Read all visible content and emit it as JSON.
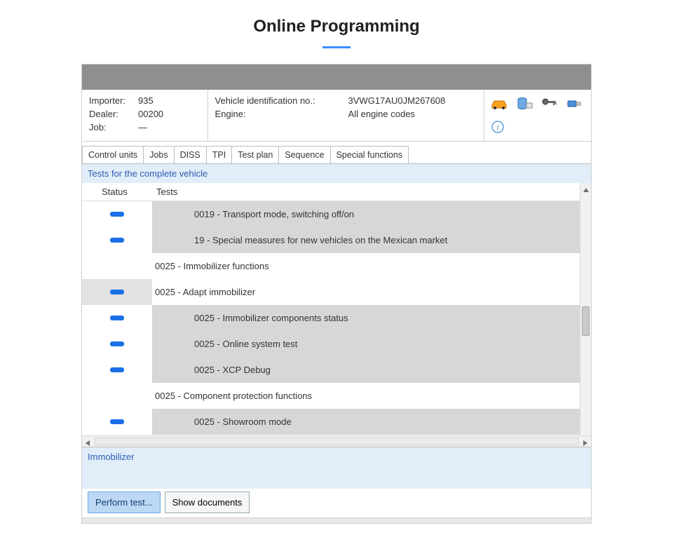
{
  "page": {
    "title": "Online Programming"
  },
  "info": {
    "importer_label": "Importer:",
    "importer_value": "935",
    "dealer_label": "Dealer:",
    "dealer_value": "00200",
    "job_label": "Job:",
    "job_value": "—",
    "vin_label": "Vehicle identification no.:",
    "vin_value": "3VWG17AU0JM267608",
    "engine_label": "Engine:",
    "engine_value": "All engine codes"
  },
  "tabs": {
    "items": [
      "Control units",
      "Jobs",
      "DISS",
      "TPI",
      "Test plan",
      "Sequence",
      "Special functions"
    ],
    "active_index": 6
  },
  "subheader": "Tests for the complete vehicle",
  "columns": {
    "status": "Status",
    "tests": "Tests"
  },
  "rows": [
    {
      "type": "test",
      "indicator": true,
      "text": "0019 - Transport mode, switching off/on"
    },
    {
      "type": "test",
      "indicator": true,
      "text": "19 - Special measures for new vehicles on the Mexican market"
    },
    {
      "type": "group",
      "indicator": false,
      "text": "0025 - Immobilizer functions"
    },
    {
      "type": "test",
      "indicator": true,
      "selected": true,
      "text": "0025 - Adapt immobilizer"
    },
    {
      "type": "test",
      "indicator": true,
      "text": "0025 - Immobilizer components status"
    },
    {
      "type": "test",
      "indicator": true,
      "text": "0025 - Online system test"
    },
    {
      "type": "test",
      "indicator": true,
      "text": "0025 - XCP Debug"
    },
    {
      "type": "group",
      "indicator": false,
      "text": "0025 - Component protection functions"
    },
    {
      "type": "test",
      "indicator": true,
      "text": "0025 - Showroom mode"
    }
  ],
  "bottom_panel_title": "Immobilizer",
  "buttons": {
    "perform": "Perform test...",
    "show_docs": "Show documents"
  },
  "icons": {
    "car": "car-icon",
    "db": "database-icon",
    "key": "key-icon",
    "usb": "usb-icon",
    "info": "info-icon"
  }
}
